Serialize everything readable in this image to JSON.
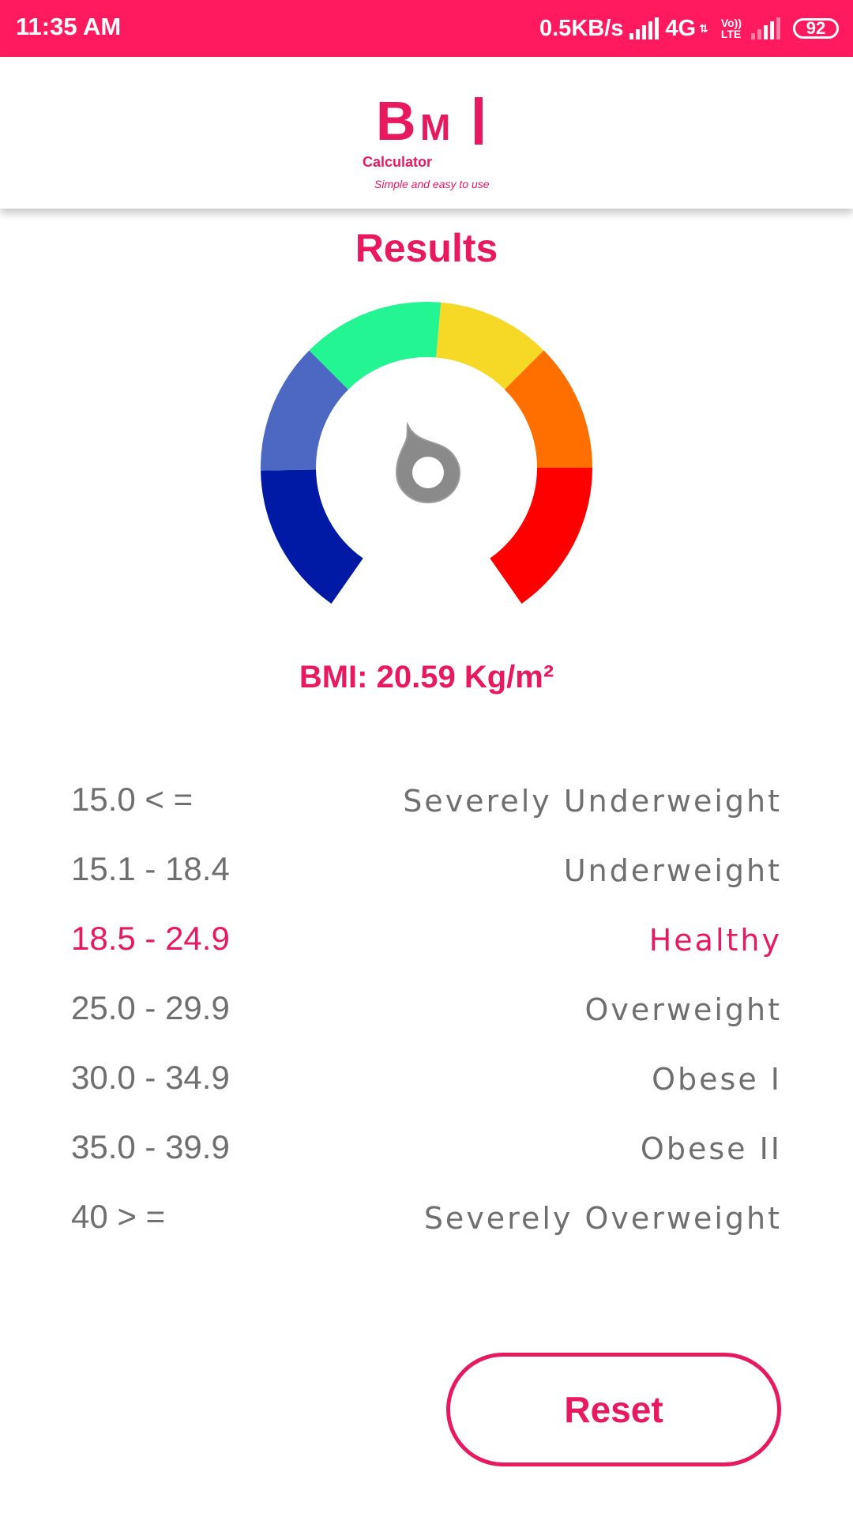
{
  "status_bar": {
    "time": "11:35 AM",
    "network_speed": "0.5KB/s",
    "network_type": "4G",
    "volte_top": "Vo))",
    "volte_bottom": "LTE",
    "battery": "92",
    "background_color": "#ff1a5f"
  },
  "header": {
    "logo": {
      "b": "B",
      "m": "M",
      "name": "Calculator",
      "tagline": "Simple and easy to use"
    }
  },
  "results": {
    "title": "Results",
    "bmi_label": "BMI:",
    "bmi_value": "20.59",
    "bmi_unit": "Kg/m²"
  },
  "gauge": {
    "segment_colors": [
      "#001aa6",
      "#4d68c2",
      "#22f592",
      "#f5d926",
      "#fe6f00",
      "#ff0000"
    ],
    "needle_icon": "gauge-needle-icon"
  },
  "ranges": [
    {
      "range": "15.0 < =",
      "category": "Severely Underweight",
      "active": false
    },
    {
      "range": "15.1 - 18.4",
      "category": "Underweight",
      "active": false
    },
    {
      "range": "18.5 - 24.9",
      "category": "Healthy",
      "active": true
    },
    {
      "range": "25.0 - 29.9",
      "category": "Overweight",
      "active": false
    },
    {
      "range": "30.0 - 34.9",
      "category": "Obese I",
      "active": false
    },
    {
      "range": "35.0 - 39.9",
      "category": "Obese II",
      "active": false
    },
    {
      "range": "40 > =",
      "category": "Severely Overweight",
      "active": false
    }
  ],
  "actions": {
    "reset_label": "Reset"
  },
  "theme": {
    "accent": "#e8195e",
    "text_muted": "#6f6f6f"
  }
}
